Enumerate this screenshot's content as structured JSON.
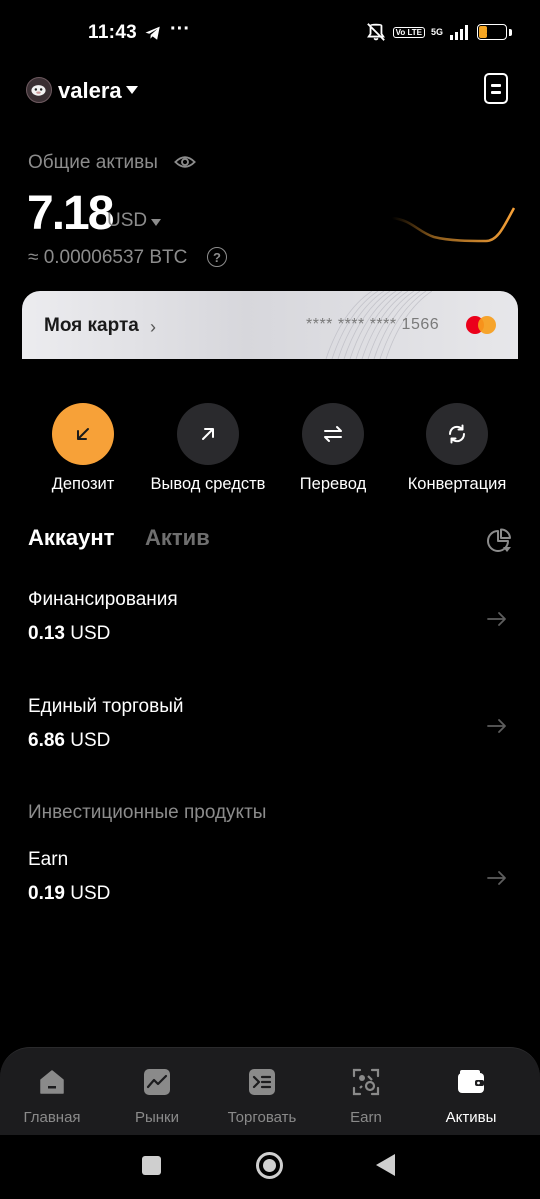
{
  "status_bar": {
    "time": "11:43",
    "dots": "···",
    "network": "5G",
    "volte": "Vo LTE",
    "battery": "30"
  },
  "header": {
    "username": "valera"
  },
  "assets": {
    "label": "Общие активы",
    "value": "7.18",
    "currency": "USD",
    "btc_equivalent": "≈ 0.00006537 BTC",
    "help_symbol": "?"
  },
  "card": {
    "title": "Моя карта",
    "chevron": "›",
    "masked_number": "**** **** **** 1566"
  },
  "actions": [
    {
      "label": "Депозит",
      "icon": "arrow-down-left-icon"
    },
    {
      "label": "Вывод средств",
      "icon": "arrow-up-right-icon"
    },
    {
      "label": "Перевод",
      "icon": "transfer-icon"
    },
    {
      "label": "Конвертация",
      "icon": "convert-icon"
    }
  ],
  "tabs": [
    {
      "label": "Аккаунт",
      "active": true
    },
    {
      "label": "Актив",
      "active": false
    }
  ],
  "accounts": [
    {
      "title": "Финансирования",
      "amount": "0.13",
      "unit": "USD"
    },
    {
      "title": "Единый торговый",
      "amount": "6.86",
      "unit": "USD"
    }
  ],
  "investment": {
    "section_label": "Инвестиционные продукты",
    "items": [
      {
        "title": "Earn",
        "amount": "0.19",
        "unit": "USD"
      }
    ]
  },
  "bottom_nav": [
    {
      "label": "Главная",
      "icon": "home-icon",
      "active": false
    },
    {
      "label": "Рынки",
      "icon": "markets-icon",
      "active": false
    },
    {
      "label": "Торговать",
      "icon": "trade-icon",
      "active": false
    },
    {
      "label": "Earn",
      "icon": "earn-icon",
      "active": false
    },
    {
      "label": "Активы",
      "icon": "wallet-icon",
      "active": true
    }
  ],
  "colors": {
    "accent": "#f7a138",
    "background": "#000000",
    "muted_text": "#8c8c8c"
  }
}
